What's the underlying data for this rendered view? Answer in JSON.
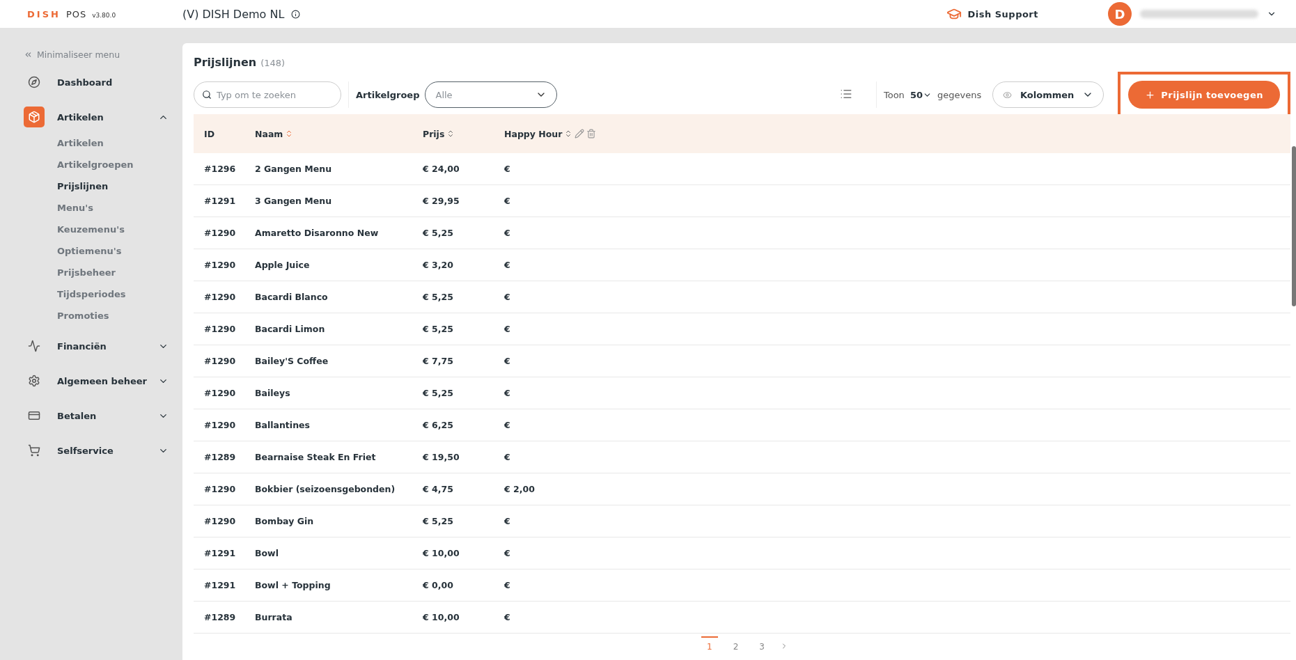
{
  "header": {
    "brand_accent": "DISH",
    "brand": "POS",
    "version": "v3.80.0",
    "venue": "(V) DISH Demo NL",
    "support": "Dish Support",
    "avatar": "D"
  },
  "sidebar": {
    "collapse": "Minimaliseer menu",
    "items": [
      {
        "label": "Dashboard",
        "kind": "link",
        "selected": false
      },
      {
        "label": "Artikelen",
        "kind": "group",
        "selected": true,
        "expanded": true,
        "children": [
          {
            "label": "Artikelen",
            "selected": false
          },
          {
            "label": "Artikelgroepen",
            "selected": false
          },
          {
            "label": "Prijslijnen",
            "selected": true
          },
          {
            "label": "Menu's",
            "selected": false
          },
          {
            "label": "Keuzemenu's",
            "selected": false
          },
          {
            "label": "Optiemenu's",
            "selected": false
          },
          {
            "label": "Prijsbeheer",
            "selected": false
          },
          {
            "label": "Tijdsperiodes",
            "selected": false
          },
          {
            "label": "Promoties",
            "selected": false
          }
        ]
      },
      {
        "label": "Financiën",
        "kind": "group",
        "selected": false,
        "expanded": false
      },
      {
        "label": "Algemeen beheer",
        "kind": "group",
        "selected": false,
        "expanded": false
      },
      {
        "label": "Betalen",
        "kind": "group",
        "selected": false,
        "expanded": false
      },
      {
        "label": "Selfservice",
        "kind": "group",
        "selected": false,
        "expanded": false
      }
    ]
  },
  "page": {
    "title": "Prijslijnen",
    "count": "(148)",
    "search": {
      "placeholder": "Typ om te zoeken"
    },
    "filter": {
      "label": "Artikelgroep",
      "value": "Alle"
    },
    "show": {
      "label": "Toon",
      "value": "50",
      "suffix": "gegevens"
    },
    "columns_button": "Kolommen",
    "add_button": {
      "label": "Prijslijn toevoegen",
      "highlighted": true
    }
  },
  "table": {
    "columns": [
      {
        "label": "ID",
        "kind": "plain"
      },
      {
        "label": "Naam",
        "kind": "sortable",
        "sorted": true
      },
      {
        "label": "Prijs",
        "kind": "sortable",
        "sorted": false
      },
      {
        "label": "Happy Hour",
        "kind": "actions",
        "sorted": false
      }
    ],
    "rows": [
      [
        "#1296",
        "2 Gangen Menu",
        "€ 24,00",
        "€"
      ],
      [
        "#1291",
        "3 Gangen Menu",
        "€ 29,95",
        "€"
      ],
      [
        "#1290",
        "Amaretto Disaronno New",
        "€ 5,25",
        "€"
      ],
      [
        "#1290",
        "Apple Juice",
        "€ 3,20",
        "€"
      ],
      [
        "#1290",
        "Bacardi Blanco",
        "€ 5,25",
        "€"
      ],
      [
        "#1290",
        "Bacardi Limon",
        "€ 5,25",
        "€"
      ],
      [
        "#1290",
        "Bailey'S Coffee",
        "€ 7,75",
        "€"
      ],
      [
        "#1290",
        "Baileys",
        "€ 5,25",
        "€"
      ],
      [
        "#1290",
        "Ballantines",
        "€ 6,25",
        "€"
      ],
      [
        "#1289",
        "Bearnaise Steak En Friet",
        "€ 19,50",
        "€"
      ],
      [
        "#1290",
        "Bokbier (seizoensgebonden)",
        "€ 4,75",
        "€ 2,00"
      ],
      [
        "#1290",
        "Bombay Gin",
        "€ 5,25",
        "€"
      ],
      [
        "#1291",
        "Bowl",
        "€ 10,00",
        "€"
      ],
      [
        "#1291",
        "Bowl + Topping",
        "€ 0,00",
        "€"
      ],
      [
        "#1289",
        "Burrata",
        "€ 10,00",
        "€"
      ]
    ]
  },
  "pagination": [
    {
      "label": "1",
      "selected": true
    },
    {
      "label": "2",
      "selected": false
    },
    {
      "label": "3",
      "selected": false
    }
  ]
}
